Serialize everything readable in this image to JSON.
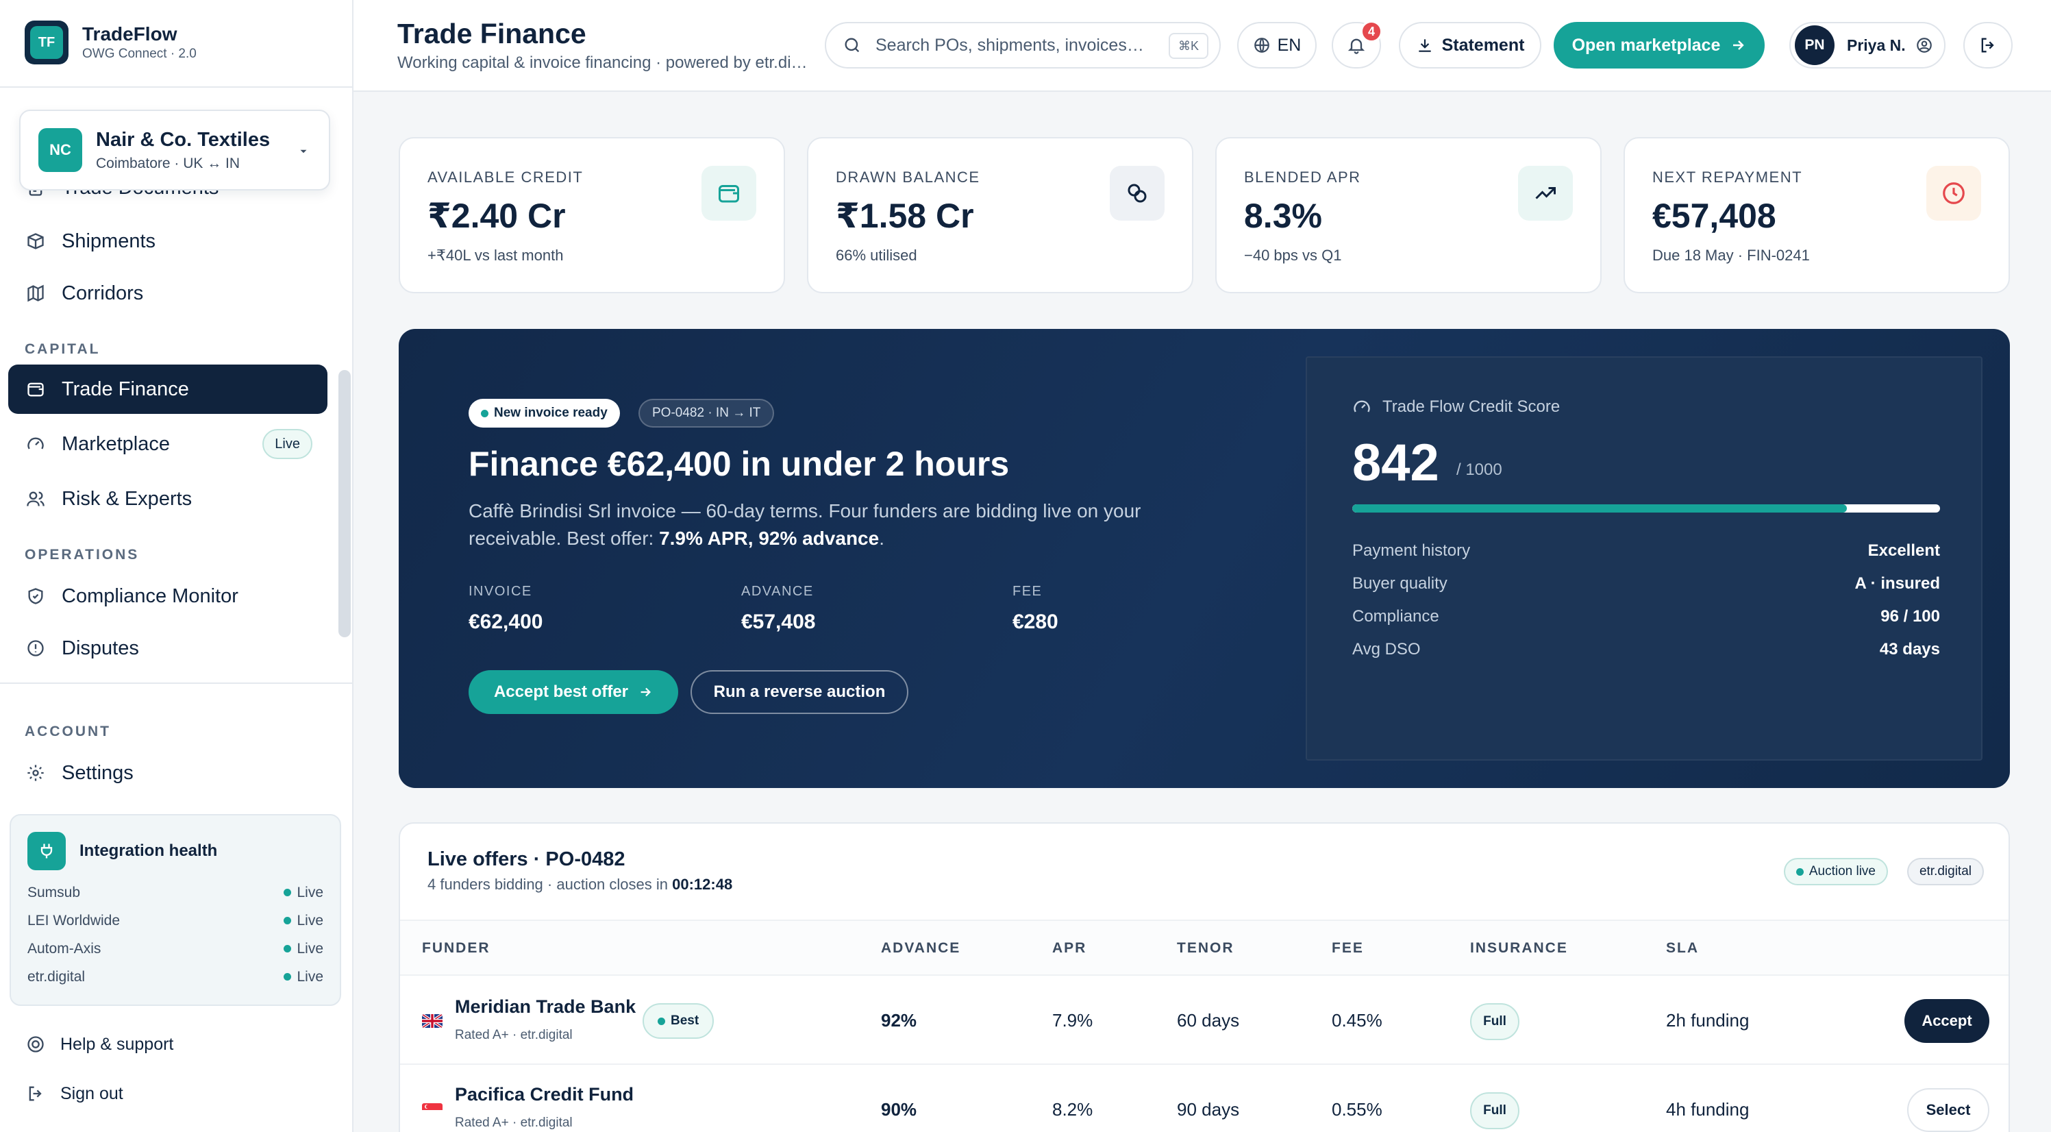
{
  "brand": {
    "logo": "TF",
    "name": "TradeFlow",
    "sub": "OWG Connect · 2.0"
  },
  "org": {
    "initials": "NC",
    "name": "Nair & Co. Textiles",
    "sub": "Coimbatore · UK ↔ IN"
  },
  "sidebar": {
    "items_top": [
      {
        "label": "Trade Documents",
        "icon": "document-icon"
      },
      {
        "label": "Shipments",
        "icon": "box-icon"
      },
      {
        "label": "Corridors",
        "icon": "map-icon"
      }
    ],
    "section_capital": "CAPITAL",
    "trade_finance": "Trade Finance",
    "marketplace": "Marketplace",
    "marketplace_badge": "Live",
    "risk": "Risk & Experts",
    "section_operations": "OPERATIONS",
    "compliance": "Compliance Monitor",
    "disputes": "Disputes",
    "section_account": "ACCOUNT",
    "settings": "Settings"
  },
  "integration": {
    "title": "Integration health",
    "rows": [
      {
        "name": "Sumsub",
        "status": "Live"
      },
      {
        "name": "LEI Worldwide",
        "status": "Live"
      },
      {
        "name": "Autom-Axis",
        "status": "Live"
      },
      {
        "name": "etr.digital",
        "status": "Live"
      }
    ]
  },
  "footer_links": {
    "help": "Help & support",
    "signout": "Sign out"
  },
  "header": {
    "title": "Trade Finance",
    "subtitle": "Working capital & invoice financing · powered by etr.digital",
    "search_placeholder": "Search POs, shipments, invoices…",
    "search_kbd": "⌘K",
    "lang": "EN",
    "notif_count": "4",
    "statement": "Statement",
    "open_marketplace": "Open marketplace",
    "user_initials": "PN",
    "user_name": "Priya N."
  },
  "stats": [
    {
      "label": "AVAILABLE CREDIT",
      "value": "₹2.40 Cr",
      "sub": "+₹40L vs last month",
      "icon": "wallet-icon"
    },
    {
      "label": "DRAWN BALANCE",
      "value": "₹1.58 Cr",
      "sub": "66% utilised",
      "icon": "coins-icon"
    },
    {
      "label": "BLENDED APR",
      "value": "8.3%",
      "sub": "−40 bps vs Q1",
      "icon": "trending-up-icon"
    },
    {
      "label": "NEXT REPAYMENT",
      "value": "€57,408",
      "sub": "Due 18 May · FIN-0241",
      "icon": "clock-icon"
    }
  ],
  "hero": {
    "badge_new": "New invoice ready",
    "badge_po": "PO-0482 · IN → IT",
    "title": "Finance €62,400 in under 2 hours",
    "desc_pre": "Caffè Brindisi Srl invoice — 60-day terms. Four funders are bidding live on your receivable. Best offer: ",
    "desc_bold": "7.9% APR, 92% advance",
    "desc_post": ".",
    "invoice_label": "INVOICE",
    "invoice_value": "€62,400",
    "advance_label": "ADVANCE",
    "advance_value": "€57,408",
    "fee_label": "FEE",
    "fee_value": "€280",
    "accept_btn": "Accept best offer",
    "auction_btn": "Run a reverse auction"
  },
  "score": {
    "title": "Trade Flow Credit Score",
    "value": "842",
    "max": "/ 1000",
    "fraction": 0.842,
    "rows": [
      {
        "k": "Payment history",
        "v": "Excellent"
      },
      {
        "k": "Buyer quality",
        "v": "A · insured"
      },
      {
        "k": "Compliance",
        "v": "96 / 100"
      },
      {
        "k": "Avg DSO",
        "v": "43 days"
      }
    ]
  },
  "offers": {
    "title": "Live offers · PO-0482",
    "sub_pre": "4 funders bidding · auction closes in ",
    "countdown": "00:12:48",
    "tag_auction": "Auction live",
    "tag_etr": "etr.digital",
    "headers": [
      "FUNDER",
      "ADVANCE",
      "APR",
      "TENOR",
      "FEE",
      "INSURANCE",
      "SLA"
    ],
    "rows": [
      {
        "funder": "Meridian Trade Bank",
        "rating": "Rated A+ · etr.digital",
        "best": "Best",
        "advance": "92%",
        "apr": "7.9%",
        "tenor": "60 days",
        "fee": "0.45%",
        "insurance": "Full",
        "sla": "2h funding",
        "action": "Accept"
      },
      {
        "funder": "Pacifica Credit Fund",
        "rating": "Rated A+ · etr.digital",
        "advance": "90%",
        "apr": "8.2%",
        "tenor": "90 days",
        "fee": "0.55%",
        "insurance": "Full",
        "sla": "4h funding",
        "action": "Select"
      }
    ]
  },
  "colors": {
    "accent": "#16a398",
    "navy": "#10233d",
    "hero_bg": "#12294a",
    "alert": "#e5484d"
  }
}
